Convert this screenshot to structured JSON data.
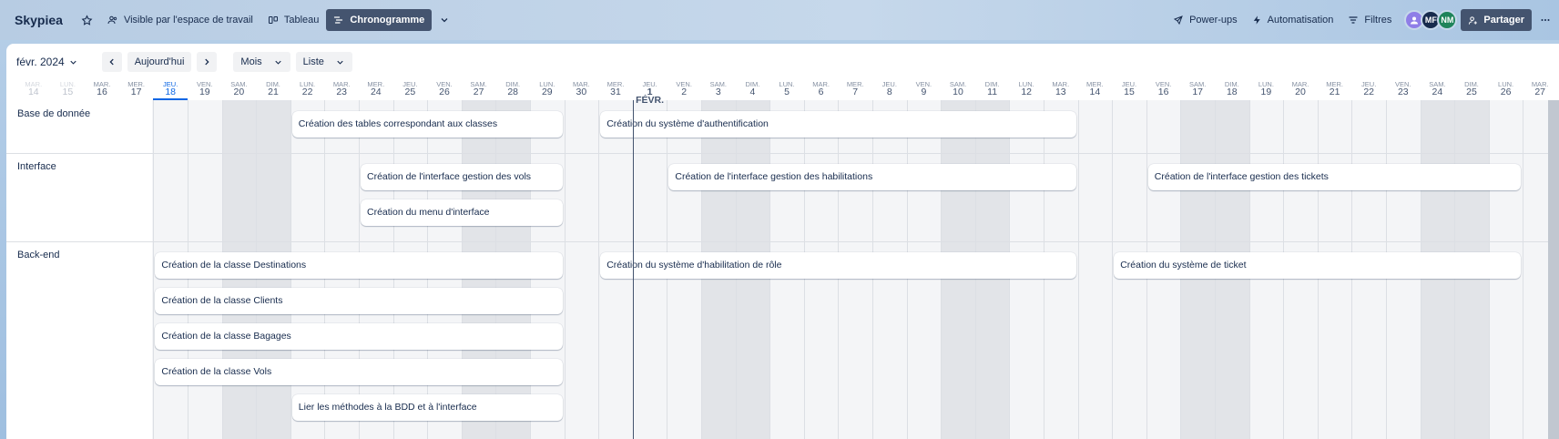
{
  "header": {
    "board_title": "Skypiea",
    "visibility_label": "Visible par l'espace de travail",
    "views": [
      {
        "label": "Tableau",
        "active": false
      },
      {
        "label": "Chronogramme",
        "active": true
      }
    ],
    "powerups_label": "Power-ups",
    "automation_label": "Automatisation",
    "filters_label": "Filtres",
    "avatars": [
      {
        "initials": "",
        "color": "#8f7ee7"
      },
      {
        "initials": "MF",
        "color": "#172b4d"
      },
      {
        "initials": "NM",
        "color": "#1f845a"
      }
    ],
    "share_label": "Partager"
  },
  "toolbar": {
    "current_period": "févr. 2024",
    "today_label": "Aujourd'hui",
    "zoom_label": "Mois",
    "group_label": "Liste"
  },
  "days": [
    {
      "name": "MAR.",
      "num": "14",
      "weekend": false,
      "faded": true
    },
    {
      "name": "LUN.",
      "num": "15",
      "weekend": false,
      "faded": true
    },
    {
      "name": "MAR.",
      "num": "16",
      "weekend": false
    },
    {
      "name": "MER.",
      "num": "17",
      "weekend": false
    },
    {
      "name": "JEU.",
      "num": "18",
      "weekend": false,
      "today": true
    },
    {
      "name": "VEN.",
      "num": "19",
      "weekend": false
    },
    {
      "name": "SAM.",
      "num": "20",
      "weekend": true
    },
    {
      "name": "DIM.",
      "num": "21",
      "weekend": true
    },
    {
      "name": "LUN.",
      "num": "22",
      "weekend": false
    },
    {
      "name": "MAR.",
      "num": "23",
      "weekend": false
    },
    {
      "name": "MER.",
      "num": "24",
      "weekend": false
    },
    {
      "name": "JEU.",
      "num": "25",
      "weekend": false
    },
    {
      "name": "VEN.",
      "num": "26",
      "weekend": false
    },
    {
      "name": "SAM.",
      "num": "27",
      "weekend": true
    },
    {
      "name": "DIM.",
      "num": "28",
      "weekend": true
    },
    {
      "name": "LUN.",
      "num": "29",
      "weekend": false
    },
    {
      "name": "MAR.",
      "num": "30",
      "weekend": false
    },
    {
      "name": "MER.",
      "num": "31",
      "weekend": false
    },
    {
      "name": "JEU.",
      "num": "1 FÉVR.",
      "weekend": false,
      "first": true
    },
    {
      "name": "VEN.",
      "num": "2",
      "weekend": false
    },
    {
      "name": "SAM.",
      "num": "3",
      "weekend": true
    },
    {
      "name": "DIM.",
      "num": "4",
      "weekend": true
    },
    {
      "name": "LUN.",
      "num": "5",
      "weekend": false
    },
    {
      "name": "MAR.",
      "num": "6",
      "weekend": false
    },
    {
      "name": "MER.",
      "num": "7",
      "weekend": false
    },
    {
      "name": "JEU.",
      "num": "8",
      "weekend": false
    },
    {
      "name": "VEN.",
      "num": "9",
      "weekend": false
    },
    {
      "name": "SAM.",
      "num": "10",
      "weekend": true
    },
    {
      "name": "DIM.",
      "num": "11",
      "weekend": true
    },
    {
      "name": "LUN.",
      "num": "12",
      "weekend": false
    },
    {
      "name": "MAR.",
      "num": "13",
      "weekend": false
    },
    {
      "name": "MER.",
      "num": "14",
      "weekend": false
    },
    {
      "name": "JEU.",
      "num": "15",
      "weekend": false
    },
    {
      "name": "VEN.",
      "num": "16",
      "weekend": false
    },
    {
      "name": "SAM.",
      "num": "17",
      "weekend": true
    },
    {
      "name": "DIM.",
      "num": "18",
      "weekend": true
    },
    {
      "name": "LUN.",
      "num": "19",
      "weekend": false
    },
    {
      "name": "MAR.",
      "num": "20",
      "weekend": false
    },
    {
      "name": "MER.",
      "num": "21",
      "weekend": false
    },
    {
      "name": "JEU.",
      "num": "22",
      "weekend": false
    },
    {
      "name": "VEN.",
      "num": "23",
      "weekend": false
    },
    {
      "name": "SAM.",
      "num": "24",
      "weekend": true
    },
    {
      "name": "DIM.",
      "num": "25",
      "weekend": true
    },
    {
      "name": "LUN.",
      "num": "26",
      "weekend": false
    },
    {
      "name": "MAR.",
      "num": "27",
      "weekend": false
    }
  ],
  "groups": [
    {
      "label": "Base de donnée",
      "lanes": 1,
      "cards": [
        {
          "title": "Création des tables correspondant aux classes",
          "start": 8,
          "end": 15,
          "lane": 0
        },
        {
          "title": "Création du système d'authentification",
          "start": 17,
          "end": 30,
          "lane": 0
        }
      ]
    },
    {
      "label": "Interface",
      "lanes": 2,
      "cards": [
        {
          "title": "Création de l'interface gestion des vols",
          "start": 10,
          "end": 15,
          "lane": 0
        },
        {
          "title": "Création de l'interface gestion des habilitations",
          "start": 19,
          "end": 30,
          "lane": 0
        },
        {
          "title": "Création de l'interface gestion des tickets",
          "start": 33,
          "end": 43,
          "lane": 0
        },
        {
          "title": "Création du menu d'interface",
          "start": 10,
          "end": 15,
          "lane": 1
        }
      ]
    },
    {
      "label": "Back-end",
      "lanes": 5,
      "cards": [
        {
          "title": "Création de la classe Destinations",
          "start": 4,
          "end": 15,
          "lane": 0
        },
        {
          "title": "Création du système d'habilitation de rôle",
          "start": 17,
          "end": 30,
          "lane": 0
        },
        {
          "title": "Création du système de ticket",
          "start": 32,
          "end": 43,
          "lane": 0
        },
        {
          "title": "Création de la classe Clients",
          "start": 4,
          "end": 15,
          "lane": 1
        },
        {
          "title": "Création de la classe Bagages",
          "start": 4,
          "end": 15,
          "lane": 2
        },
        {
          "title": "Création de la classe Vols",
          "start": 4,
          "end": 15,
          "lane": 3
        },
        {
          "title": "Lier les méthodes à la BDD et à l'interface",
          "start": 8,
          "end": 15,
          "lane": 4
        }
      ]
    }
  ]
}
